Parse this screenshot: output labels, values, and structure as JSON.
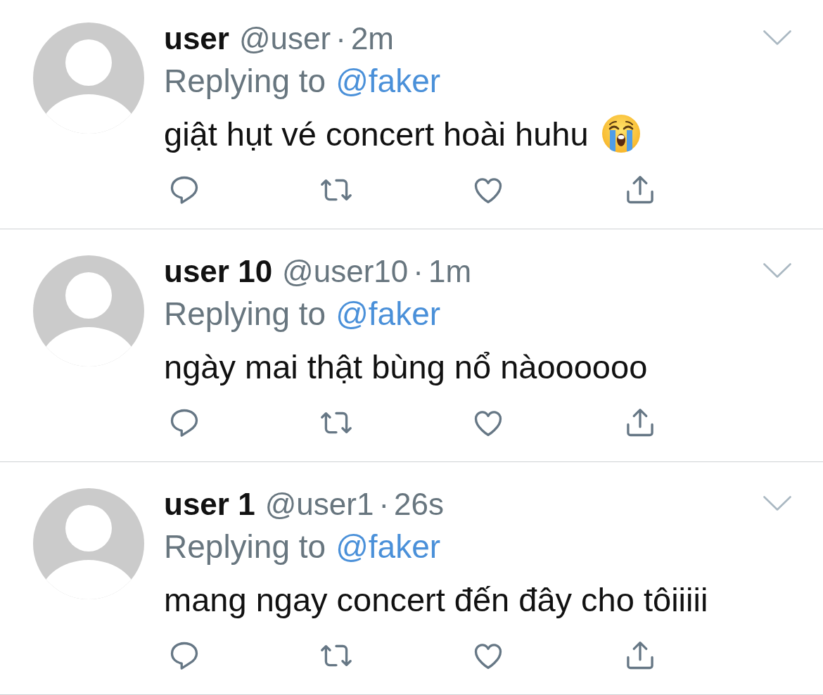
{
  "tweets": [
    {
      "name": "user",
      "handle": "@user",
      "separator": "·",
      "time": "2m",
      "replying_to": {
        "label": "Replying to",
        "mention": "@faker"
      },
      "text": "giật hụt vé concert hoài huhu",
      "emoji": true
    },
    {
      "name": "user 10",
      "handle": "@user10",
      "separator": "·",
      "time": "1m",
      "replying_to": {
        "label": "Replying to",
        "mention": "@faker"
      },
      "text": "ngày mai thật bùng nổ nàoooooo",
      "emoji": false
    },
    {
      "name": "user 1",
      "handle": "@user1",
      "separator": "·",
      "time": "26s",
      "replying_to": {
        "label": "Replying to",
        "mention": "@faker"
      },
      "text": "mang ngay concert đến đây cho tôiiiii",
      "emoji": false
    }
  ]
}
